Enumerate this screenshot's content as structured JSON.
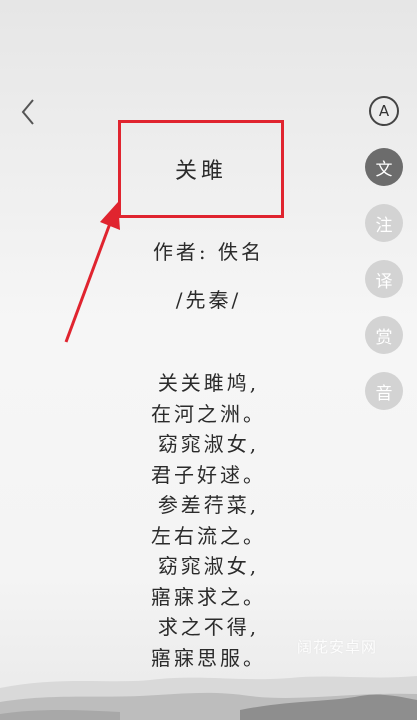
{
  "poem": {
    "title": "关雎",
    "author_line": "作者: 佚名",
    "dynasty_line": "/先秦/",
    "lines": [
      "关关雎鸠,",
      "在河之洲。",
      "窈窕淑女,",
      "君子好逑。",
      "参差荇菜,",
      "左右流之。",
      "窈窕淑女,",
      "寤寐求之。",
      "求之不得,",
      "寤寐思服。"
    ]
  },
  "sidebar": {
    "font_button": "A",
    "tabs": [
      "文",
      "注",
      "译",
      "赏",
      "音"
    ],
    "active_tab": 0
  },
  "watermark": "阔花安卓网",
  "colors": {
    "highlight_border": "#e0242f",
    "active_tab_bg": "#6c6c6c",
    "inactive_tab_bg": "#d3d3d3"
  },
  "icons": [
    "back-chevron-icon",
    "font-a-icon",
    "annotation-arrow-icon"
  ]
}
